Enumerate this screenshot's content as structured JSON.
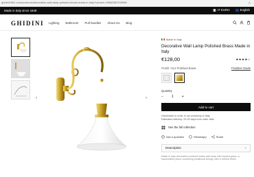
{
  "browser": {
    "url": "ghidini1961.com/products/decorative-wall-lamp-polished-brass-made-in-italy?variant=15868382150658",
    "bookmark_icon": "star-icon"
  },
  "announcement": {
    "left": "Made in Italy since 1849",
    "currency": "IT EURO",
    "language": "English"
  },
  "header": {
    "logo": "GHIDINI",
    "nav": [
      "Lighting",
      "Bathroom",
      "Pull handles",
      "About Us",
      "Blog"
    ]
  },
  "product": {
    "made_in": "Made in Italy",
    "title": "Decorative Wall Lamp Polished Brass Made in Italy",
    "price": "€128,00",
    "rating": "★★★★☆",
    "finish_label": "Finish: OL2 Polished Brass",
    "finish_guide": "Finishes Guide",
    "quantity_label": "Quantity",
    "quantity_value": "1",
    "minus": "−",
    "plus": "+",
    "add_to_cart": "Add to cart",
    "note_1": "Handmade to order in our workshop in Italy.",
    "note_2": "Estimated delivery: 20-25 days from order date",
    "collection": "See the full collection",
    "ask": "Ask a question",
    "whatsapp": "WhatsApp",
    "share": "Share",
    "description_label": "Description",
    "description_toggle": "−",
    "description_text": "Made in Italy decorative polished brass wall lamp with frosted glass; a handcrafted piece combining traditional design with a refined finish."
  },
  "gallery": {
    "prev": "‹",
    "next": "›"
  },
  "colors": {
    "brass": "#c9a227",
    "dark": "#0d0d0d"
  }
}
